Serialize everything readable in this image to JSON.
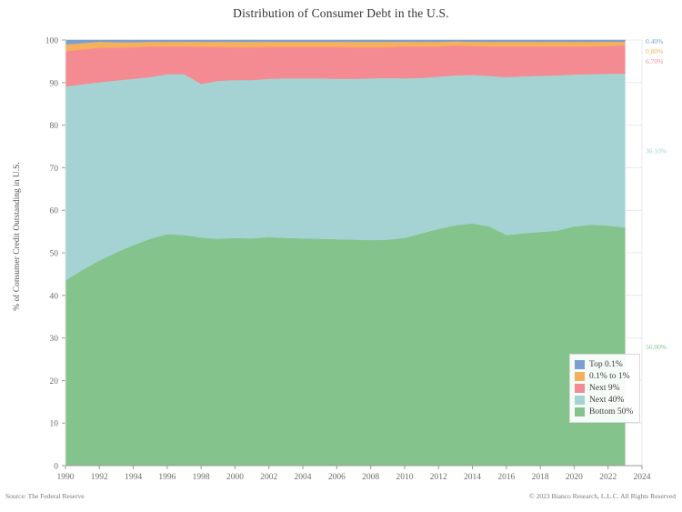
{
  "title": "Distribution of Consumer Debt in the U.S.",
  "footer": {
    "source": "Source: The Federal Reserve",
    "copyright": "© 2023 Bianco Research, L.L.C. All Rights Reserved"
  },
  "legend": {
    "position": "bottom-right",
    "items": [
      {
        "label": "Top 0.1%",
        "color": "#7b9fd0"
      },
      {
        "label": "0.1% to 1%",
        "color": "#f5b05c"
      },
      {
        "label": "Next 9%",
        "color": "#f58b92"
      },
      {
        "label": "Next 40%",
        "color": "#a5d3d3"
      },
      {
        "label": "Bottom 50%",
        "color": "#84c48c"
      }
    ]
  },
  "end_labels": [
    {
      "text": "0.40%",
      "color": "#7b9fd0",
      "value": 0.4
    },
    {
      "text": "0.80%",
      "color": "#f5b05c",
      "value": 0.8
    },
    {
      "text": "6.70%",
      "color": "#f58b92",
      "value": 6.7
    },
    {
      "text": "36.10%",
      "color": "#a5d3d3",
      "value": 36.1
    },
    {
      "text": "56.00%",
      "color": "#84c48c",
      "value": 56.0
    }
  ],
  "chart_data": {
    "type": "area",
    "stacked": true,
    "stack_total": 100,
    "title": "Distribution of Consumer Debt in the U.S.",
    "xlabel": "",
    "ylabel": "% of Consumer Credit Outstanding in U.S.",
    "xlim": [
      1990,
      2024
    ],
    "ylim": [
      0,
      100
    ],
    "grid": true,
    "yticks": [
      0,
      10,
      20,
      30,
      40,
      50,
      60,
      70,
      80,
      90,
      100
    ],
    "xticks": [
      1990,
      1992,
      1994,
      1996,
      1998,
      2000,
      2002,
      2004,
      2006,
      2008,
      2010,
      2012,
      2014,
      2016,
      2018,
      2020,
      2022,
      2024
    ],
    "x": [
      1990,
      1991,
      1992,
      1993,
      1994,
      1995,
      1996,
      1997,
      1998,
      1999,
      2000,
      2001,
      2002,
      2003,
      2004,
      2005,
      2006,
      2007,
      2008,
      2009,
      2010,
      2011,
      2012,
      2013,
      2014,
      2015,
      2016,
      2017,
      2018,
      2019,
      2020,
      2021,
      2022,
      2023
    ],
    "series": [
      {
        "name": "Bottom 50%",
        "color": "#84c48c",
        "values": [
          43.5,
          46.0,
          48.2,
          50.1,
          51.8,
          53.3,
          54.4,
          54.2,
          53.6,
          53.3,
          53.5,
          53.4,
          53.7,
          53.5,
          53.4,
          53.3,
          53.2,
          53.1,
          53.0,
          53.1,
          53.5,
          54.6,
          55.6,
          56.5,
          56.9,
          56.2,
          54.2,
          54.6,
          54.9,
          55.2,
          56.2,
          56.6,
          56.4,
          56.0
        ]
      },
      {
        "name": "Next 40%",
        "color": "#a5d3d3",
        "values": [
          45.6,
          43.6,
          41.9,
          40.4,
          39.1,
          38.0,
          37.6,
          37.8,
          36.1,
          37.1,
          37.1,
          37.2,
          37.2,
          37.5,
          37.6,
          37.7,
          37.7,
          37.8,
          38.0,
          38.0,
          37.5,
          36.5,
          35.8,
          35.2,
          34.9,
          35.4,
          37.1,
          36.9,
          36.7,
          36.5,
          35.7,
          35.4,
          35.7,
          36.1
        ]
      },
      {
        "name": "Next 9%",
        "color": "#f58b92",
        "values": [
          8.3,
          8.2,
          8.1,
          7.7,
          7.4,
          7.2,
          6.5,
          6.5,
          8.7,
          8.0,
          7.7,
          7.7,
          7.5,
          7.4,
          7.4,
          7.4,
          7.5,
          7.4,
          7.3,
          7.2,
          7.5,
          7.4,
          7.1,
          7.0,
          6.8,
          6.9,
          7.2,
          7.0,
          6.9,
          6.8,
          6.6,
          6.5,
          6.5,
          6.7
        ]
      },
      {
        "name": "0.1% to 1%",
        "color": "#f5b05c",
        "values": [
          1.6,
          1.5,
          1.4,
          1.3,
          1.2,
          1.1,
          1.1,
          1.1,
          1.2,
          1.2,
          1.3,
          1.3,
          1.2,
          1.2,
          1.2,
          1.2,
          1.2,
          1.3,
          1.3,
          1.3,
          1.1,
          1.1,
          1.1,
          1.0,
          1.0,
          1.1,
          1.1,
          1.1,
          1.1,
          1.1,
          1.1,
          1.1,
          1.0,
          0.8
        ]
      },
      {
        "name": "Top 0.1%",
        "color": "#7b9fd0",
        "values": [
          1.0,
          0.7,
          0.4,
          0.5,
          0.5,
          0.4,
          0.4,
          0.4,
          0.4,
          0.4,
          0.4,
          0.4,
          0.4,
          0.4,
          0.4,
          0.4,
          0.4,
          0.4,
          0.4,
          0.4,
          0.4,
          0.4,
          0.4,
          0.3,
          0.4,
          0.4,
          0.4,
          0.4,
          0.4,
          0.4,
          0.4,
          0.4,
          0.4,
          0.4
        ]
      }
    ]
  }
}
